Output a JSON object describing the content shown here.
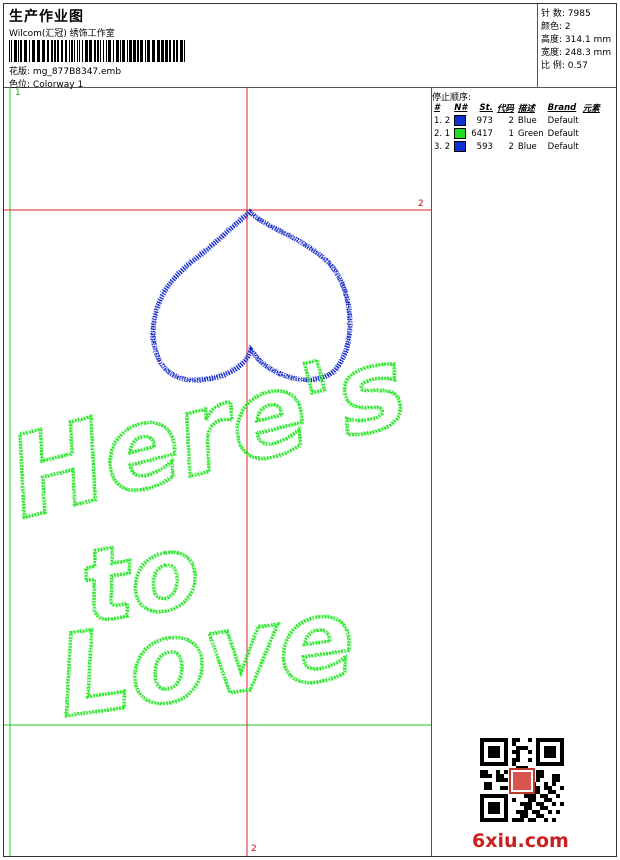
{
  "header": {
    "title": "生产作业图",
    "company": "Wilcom(汇冠) 绣饰工作室",
    "design_label": "花版:",
    "design_value": "mg_877B8347.emb",
    "colorway_label": "色位:",
    "colorway_value": "Colorway 1"
  },
  "stats": [
    {
      "label": "针 数:",
      "value": "7985"
    },
    {
      "label": "颜色:",
      "value": "2"
    },
    {
      "label": "高度:",
      "value": "314.1 mm"
    },
    {
      "label": "宽度:",
      "value": "248.3 mm"
    },
    {
      "label": "比 例:",
      "value": "0.57"
    }
  ],
  "stop_sequence": {
    "title": "停止顺序:",
    "columns": [
      "#",
      "N#",
      "St.",
      "代码",
      "描述",
      "Brand",
      "元素"
    ],
    "rows": [
      {
        "seq": "1. 2",
        "color": "#1030d0",
        "st": "973",
        "code": "2",
        "desc": "Blue",
        "brand": "Default"
      },
      {
        "seq": "2. 1",
        "color": "#22dd22",
        "st": "6417",
        "code": "1",
        "desc": "Green",
        "brand": "Default"
      },
      {
        "seq": "3. 2",
        "color": "#1030d0",
        "st": "593",
        "code": "2",
        "desc": "Blue",
        "brand": "Default"
      }
    ]
  },
  "canvas": {
    "guide_labels": {
      "top": "1",
      "right": "2",
      "bottom": "2"
    },
    "colors": {
      "heart": "#1a2fc8",
      "text": "#2ee82e",
      "guide_red": "#e02020",
      "guide_green": "#22cc22"
    },
    "design_text": [
      "Here's",
      "to",
      "Love"
    ]
  },
  "watermark": "6xiu.com"
}
